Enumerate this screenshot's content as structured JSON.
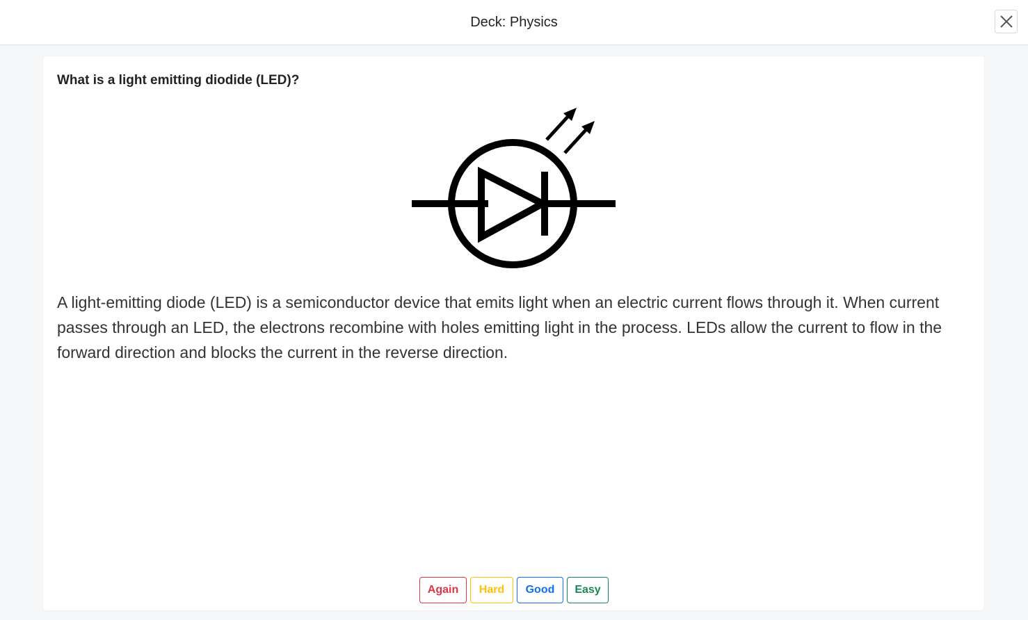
{
  "header": {
    "title": "Deck: Physics",
    "close_icon": "close-icon"
  },
  "card": {
    "question": "What is a light emitting diodide (LED)?",
    "figure_icon": "led-schematic-symbol",
    "answer": "A light-emitting diode (LED) is a semiconductor device that emits light when an electric current flows through it. When current passes through an LED, the electrons recombine with holes emitting light in the process. LEDs allow the current to flow in the forward direction and blocks the current in the reverse direction."
  },
  "ratings": [
    {
      "label": "Again",
      "color": "#dc3545"
    },
    {
      "label": "Hard",
      "color": "#ffc107"
    },
    {
      "label": "Good",
      "color": "#0d6efd"
    },
    {
      "label": "Easy",
      "color": "#198754"
    }
  ]
}
